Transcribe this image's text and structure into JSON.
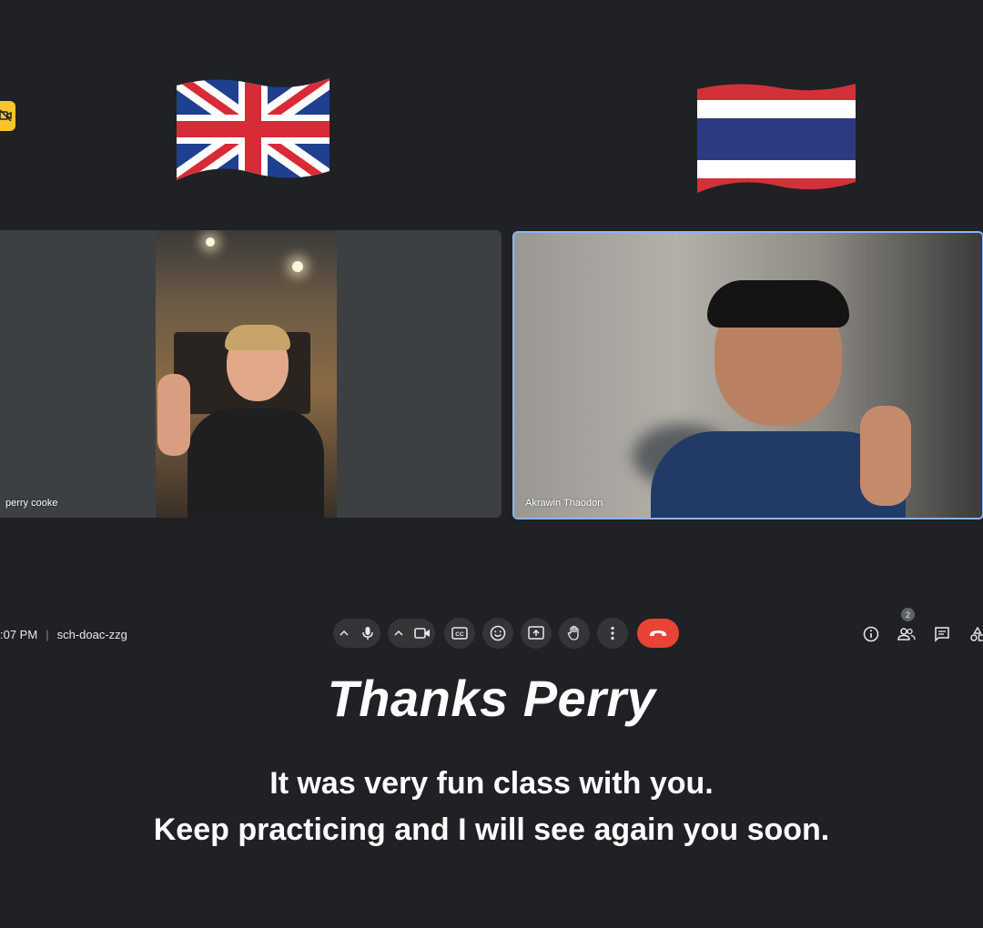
{
  "participants": [
    {
      "name": "perry cooke",
      "flag": "united-kingdom-flag"
    },
    {
      "name": "Akrawin Thaodon",
      "flag": "thailand-flag"
    }
  ],
  "meeting": {
    "time": ":07 PM",
    "code": "sch-doac-zzg"
  },
  "toolbar": {
    "controls": [
      "microphone",
      "camera",
      "captions",
      "reactions",
      "present",
      "raise-hand",
      "more-options",
      "leave-call"
    ],
    "people_count": "2",
    "end_call_color": "#ea4335",
    "active_speaker_border": "#8ab4f8",
    "badge_color": "#f9c52b"
  },
  "captions": {
    "title": "Thanks Perry",
    "line1": "It was very fun class with you.",
    "line2": "Keep practicing and I will see again you soon."
  }
}
